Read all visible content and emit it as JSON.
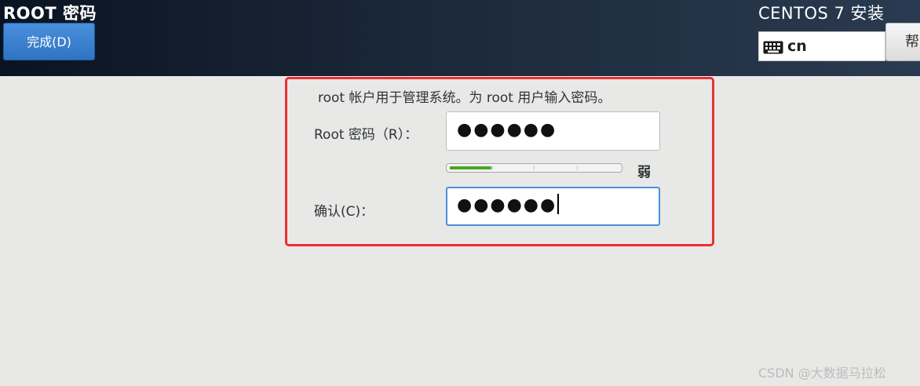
{
  "header": {
    "title": "ROOT 密码",
    "done_button": "完成(D)",
    "install_title": "CENTOS 7 安装",
    "keyboard_layout": "cn",
    "keyboard_icon": "keyboard-icon",
    "help_button": "帮"
  },
  "form": {
    "description": "root 帐户用于管理系统。为 root 用户输入密码。",
    "password_label": "Root 密码（R）：",
    "password_value": "●●●●●●",
    "confirm_label": "确认(C)：",
    "confirm_value": "●●●●●●",
    "strength_label": "弱",
    "strength_fraction": 0.25
  },
  "colors": {
    "highlight": "#ec2f2f",
    "done_button": "#3a80cf",
    "strength_fill": "#4ca423",
    "focus_border": "#4a90d9"
  },
  "watermark": "CSDN @大数据马拉松"
}
